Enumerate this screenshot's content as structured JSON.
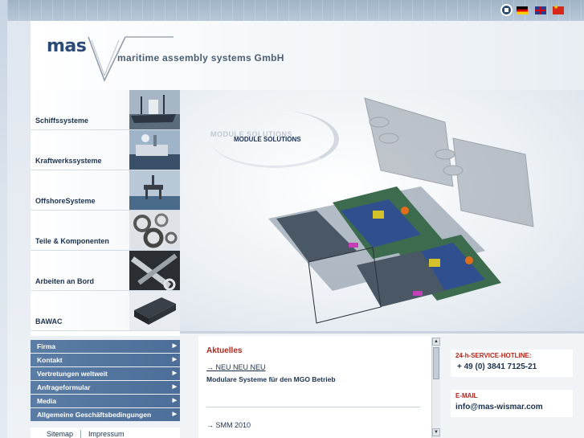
{
  "search": {
    "placeholder": ""
  },
  "header": {
    "logo_mark": "mas",
    "company": "maritime assembly systems GmbH"
  },
  "tiles": [
    {
      "label": "Schiffssysteme"
    },
    {
      "label": "Kraftwerkssysteme"
    },
    {
      "label": "OffshoreSysteme"
    },
    {
      "label": "Teile & Komponenten"
    },
    {
      "label": "Arbeiten an Bord"
    },
    {
      "label": "BAWAC"
    }
  ],
  "menu": [
    {
      "label": "Firma"
    },
    {
      "label": "Kontakt"
    },
    {
      "label": "Vertretungen weltweit"
    },
    {
      "label": "Anfrageformular"
    },
    {
      "label": "Media"
    },
    {
      "label": "Allgemeine Geschäftsbedingungen"
    }
  ],
  "menu_arrow": "▶",
  "footer": {
    "sitemap": "Sitemap",
    "impressum": "Impressum"
  },
  "hero": {
    "ghost_title": "MODULE SOLUTIONS",
    "title": "MODULE SOLUTIONS"
  },
  "news": {
    "title": "Aktuelles",
    "item1_link": "NEU  NEU  NEU",
    "item1_text": "Modulare Systeme für den MGO Betrieb",
    "item2_link": "SMM 2010",
    "bullet": "→"
  },
  "hotline": {
    "label": "24-h-SERVICE-HOTLINE:",
    "value": "+ 49 (0) 3841 7125-21"
  },
  "email": {
    "label": "E-MAIL",
    "value": "info@mas-wismar.com"
  },
  "colors": {
    "accent": "#b1271c",
    "navy": "#1b3150",
    "menu": "#4c6e98"
  }
}
